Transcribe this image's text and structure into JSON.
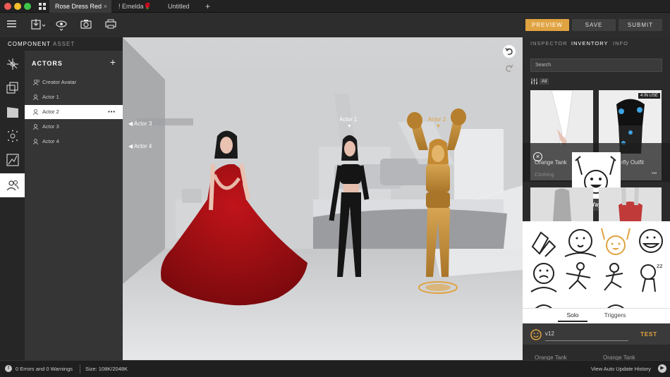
{
  "window": {
    "tabs": [
      {
        "label": "Rose Dress Red",
        "close": "×"
      },
      {
        "label": "! Emelda🌹"
      },
      {
        "label": "Untitled"
      }
    ],
    "new_tab": "+"
  },
  "toolbar": {
    "icons": [
      "menu-icon",
      "import-icon",
      "eye-icon",
      "camera-icon",
      "printer-icon"
    ],
    "preview_label": "PREVIEW",
    "save_label": "SAVE",
    "submit_label": "SUBMIT",
    "accent": "#e0a341"
  },
  "left": {
    "tabs": [
      "COMPONENT",
      "ASSET"
    ],
    "rail_icons": [
      "transform-icon",
      "layers-icon",
      "clapperboard-icon",
      "particles-icon",
      "graph-icon",
      "people-icon"
    ],
    "actors_title": "ACTORS",
    "add": "+",
    "actors": [
      "Creator Avatar",
      "Actor 1",
      "Actor 2",
      "Actor 3",
      "Actor 4"
    ],
    "more": "•••"
  },
  "viewport": {
    "labels": {
      "actor3": "Actor 3",
      "actor4": "Actor 4",
      "actor1": "Actor 1",
      "actor2": "Actor 2"
    }
  },
  "right": {
    "tabs": [
      "INSPECTOR",
      "INVENTORY",
      "INFO"
    ],
    "search_placeholder": "Search",
    "filter_all": "All",
    "in_use": "4 IN USE",
    "cards": [
      {
        "title": "Orange Tank",
        "sub": "Clothing"
      },
      {
        "title": "rfly Outfit",
        "sub": "•••"
      }
    ],
    "bottom_cards": [
      {
        "title": "Orange Tank"
      },
      {
        "title": "Orange Tank"
      }
    ],
    "emote_tooltip": "Yay",
    "emote_tabs": [
      "Solo",
      "Triggers"
    ],
    "emote_input": "v12",
    "test_label": "TEST"
  },
  "status": {
    "errors": "0 Errors and 0 Warnings",
    "size": "Size: 108K/2048K",
    "history": "View Auto Update History"
  }
}
